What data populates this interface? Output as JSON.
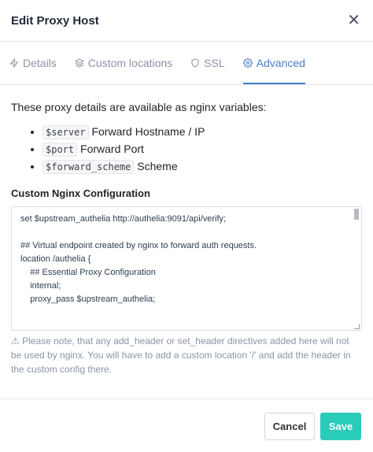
{
  "dialog": {
    "title": "Edit Proxy Host"
  },
  "tabs": [
    {
      "label": "Details",
      "icon": "zap-icon"
    },
    {
      "label": "Custom locations",
      "icon": "layers-icon"
    },
    {
      "label": "SSL",
      "icon": "shield-icon"
    },
    {
      "label": "Advanced",
      "icon": "gear-icon",
      "active": true
    }
  ],
  "intro": "These proxy details are available as nginx variables:",
  "variables": [
    {
      "code": "$server",
      "desc": "Forward Hostname / IP"
    },
    {
      "code": "$port",
      "desc": "Forward Port"
    },
    {
      "code": "$forward_scheme",
      "desc": "Scheme"
    }
  ],
  "config": {
    "label": "Custom Nginx Configuration",
    "lines": [
      "set $upstream_authelia http://authelia:9091/api/verify;",
      "",
      "## Virtual endpoint created by nginx to forward auth requests.",
      "location /authelia {",
      "    ## Essential Proxy Configuration",
      "    internal;",
      "    proxy_pass $upstream_authelia;"
    ]
  },
  "note": "Please note, that any add_header or set_header directives added here will not be used by nginx. You will have to add a custom location '/' and add the header in the custom config there.",
  "footer": {
    "cancel_label": "Cancel",
    "save_label": "Save"
  },
  "colors": {
    "accent": "#467fcf",
    "save": "#2bcbba"
  }
}
